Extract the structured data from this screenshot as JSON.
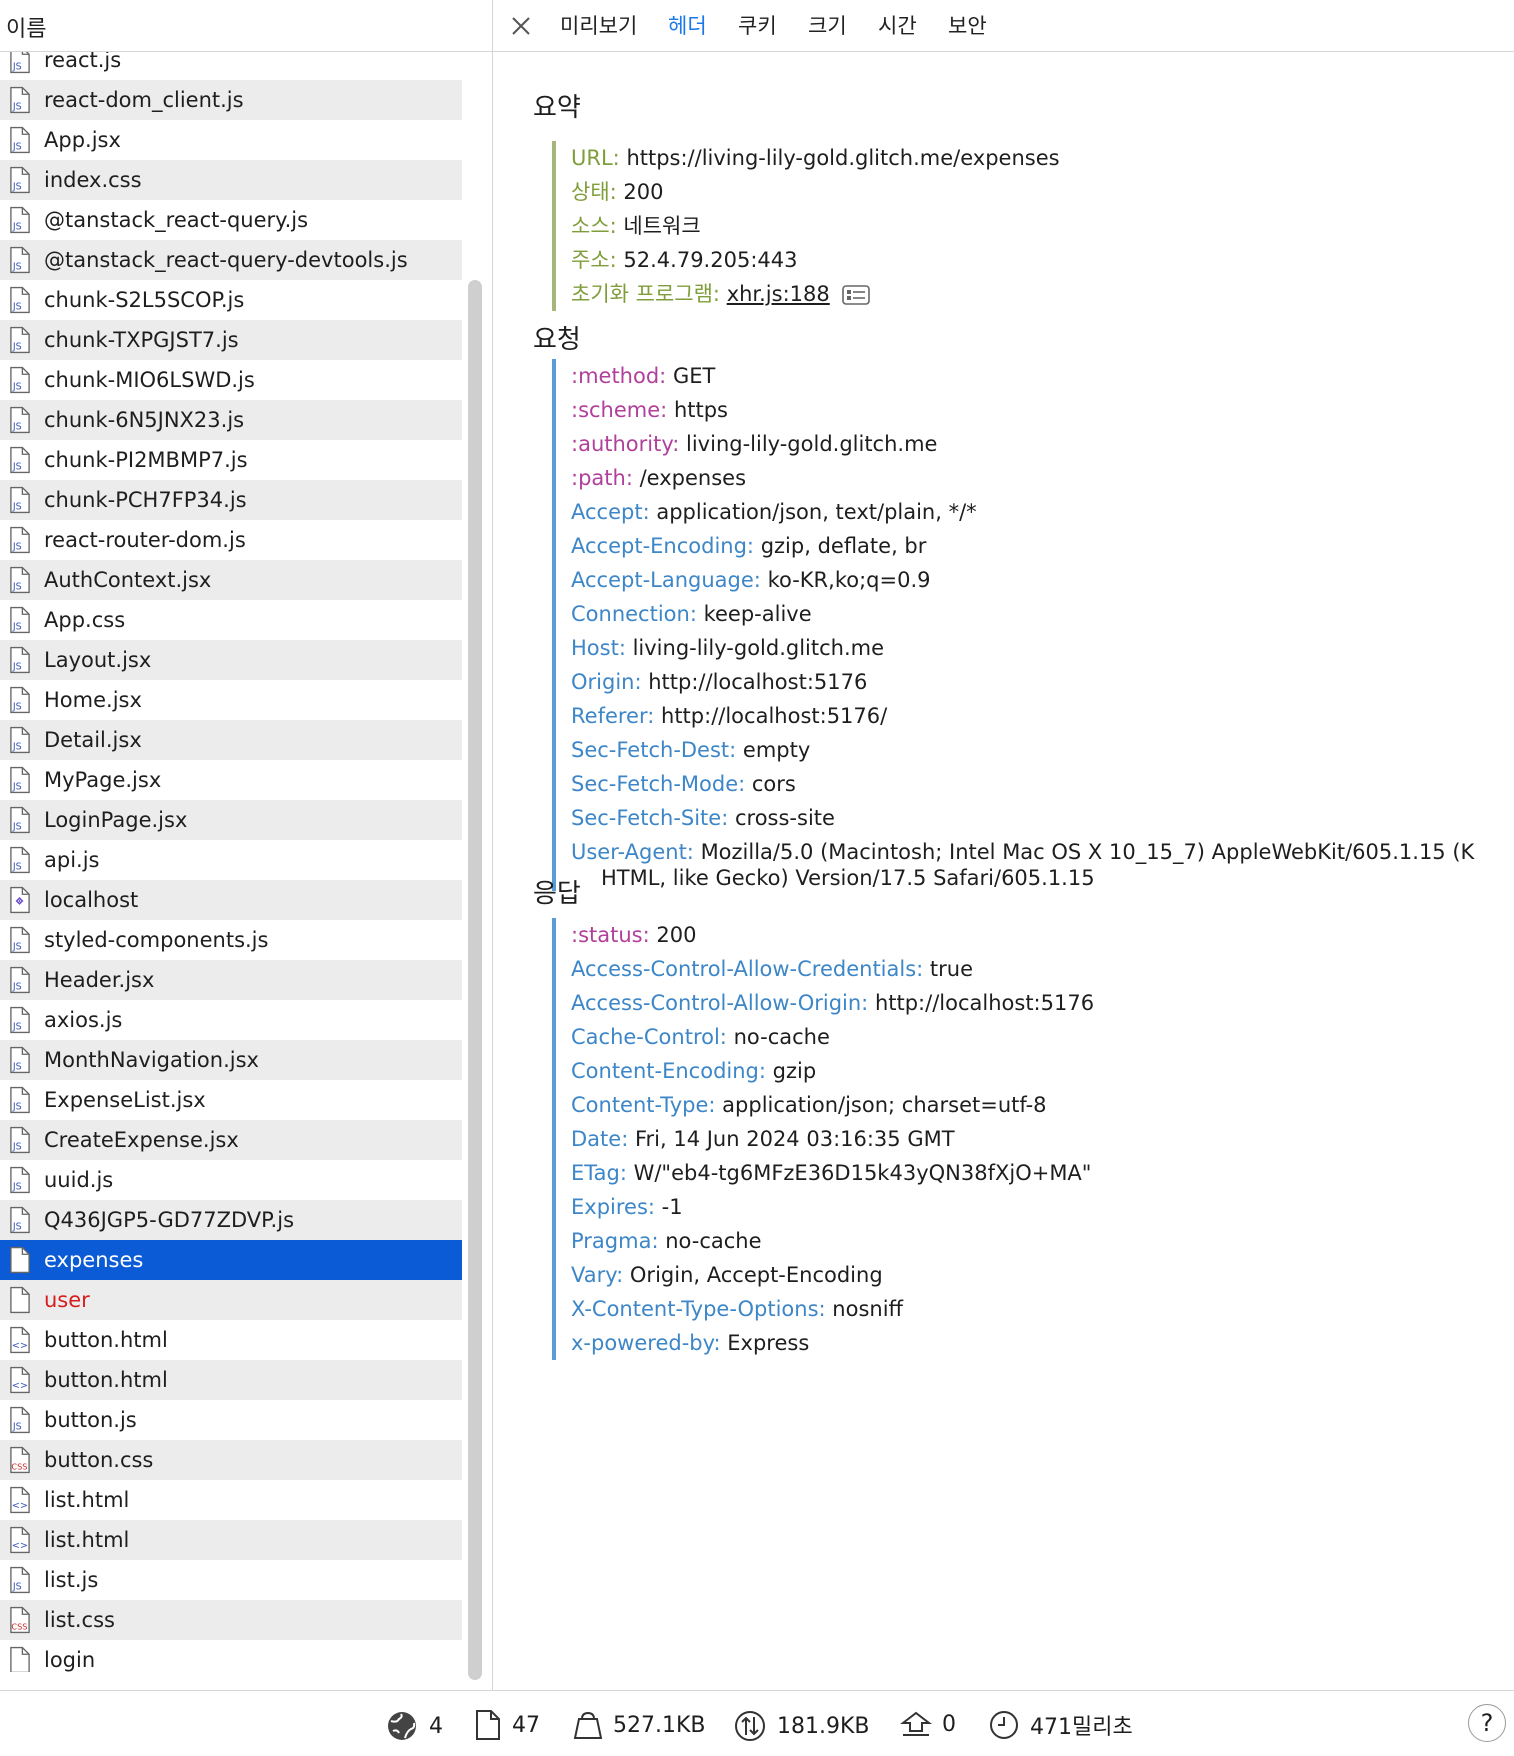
{
  "left": {
    "header": "이름",
    "files": [
      {
        "name": "react.js",
        "type": "js"
      },
      {
        "name": "react-dom_client.js",
        "type": "js"
      },
      {
        "name": "App.jsx",
        "type": "js"
      },
      {
        "name": "index.css",
        "type": "js"
      },
      {
        "name": "@tanstack_react-query.js",
        "type": "js"
      },
      {
        "name": "@tanstack_react-query-devtools.js",
        "type": "js"
      },
      {
        "name": "chunk-S2L5SCOP.js",
        "type": "js"
      },
      {
        "name": "chunk-TXPGJST7.js",
        "type": "js"
      },
      {
        "name": "chunk-MIO6LSWD.js",
        "type": "js"
      },
      {
        "name": "chunk-6N5JNX23.js",
        "type": "js"
      },
      {
        "name": "chunk-PI2MBMP7.js",
        "type": "js"
      },
      {
        "name": "chunk-PCH7FP34.js",
        "type": "js"
      },
      {
        "name": "react-router-dom.js",
        "type": "js"
      },
      {
        "name": "AuthContext.jsx",
        "type": "js"
      },
      {
        "name": "App.css",
        "type": "js"
      },
      {
        "name": "Layout.jsx",
        "type": "js"
      },
      {
        "name": "Home.jsx",
        "type": "js"
      },
      {
        "name": "Detail.jsx",
        "type": "js"
      },
      {
        "name": "MyPage.jsx",
        "type": "js"
      },
      {
        "name": "LoginPage.jsx",
        "type": "js"
      },
      {
        "name": "api.js",
        "type": "js"
      },
      {
        "name": "localhost",
        "type": "localhost"
      },
      {
        "name": "styled-components.js",
        "type": "js"
      },
      {
        "name": "Header.jsx",
        "type": "js"
      },
      {
        "name": "axios.js",
        "type": "js"
      },
      {
        "name": "MonthNavigation.jsx",
        "type": "js"
      },
      {
        "name": "ExpenseList.jsx",
        "type": "js"
      },
      {
        "name": "CreateExpense.jsx",
        "type": "js"
      },
      {
        "name": "uuid.js",
        "type": "js"
      },
      {
        "name": "Q436JGP5-GD77ZDVP.js",
        "type": "js"
      },
      {
        "name": "expenses",
        "type": "doc",
        "state": "selected"
      },
      {
        "name": "user",
        "type": "doc",
        "state": "error"
      },
      {
        "name": "button.html",
        "type": "html"
      },
      {
        "name": "button.html",
        "type": "html"
      },
      {
        "name": "button.js",
        "type": "js"
      },
      {
        "name": "button.css",
        "type": "css"
      },
      {
        "name": "list.html",
        "type": "html"
      },
      {
        "name": "list.html",
        "type": "html"
      },
      {
        "name": "list.js",
        "type": "js"
      },
      {
        "name": "list.css",
        "type": "css"
      },
      {
        "name": "login",
        "type": "doc"
      }
    ]
  },
  "tabs": [
    {
      "label": "미리보기",
      "active": false
    },
    {
      "label": "헤더",
      "active": true
    },
    {
      "label": "쿠키",
      "active": false
    },
    {
      "label": "크기",
      "active": false
    },
    {
      "label": "시간",
      "active": false
    },
    {
      "label": "보안",
      "active": false
    }
  ],
  "summary": {
    "title": "요약",
    "url_key": "URL:",
    "url_value": "https://living-lily-gold.glitch.me/expenses",
    "status_key": "상태:",
    "status_value": "200",
    "source_key": "소스:",
    "source_value": "네트워크",
    "address_key": "주소:",
    "address_value": "52.4.79.205:443",
    "initiator_key": "초기화 프로그램:",
    "initiator_value": "xhr.js:188"
  },
  "request": {
    "title": "요청",
    "headers": [
      {
        "key": ":method:",
        "value": "GET",
        "pseudo": true
      },
      {
        "key": ":scheme:",
        "value": "https",
        "pseudo": true
      },
      {
        "key": ":authority:",
        "value": "living-lily-gold.glitch.me",
        "pseudo": true
      },
      {
        "key": ":path:",
        "value": "/expenses",
        "pseudo": true
      },
      {
        "key": "Accept:",
        "value": "application/json, text/plain, */*"
      },
      {
        "key": "Accept-Encoding:",
        "value": "gzip, deflate, br"
      },
      {
        "key": "Accept-Language:",
        "value": "ko-KR,ko;q=0.9"
      },
      {
        "key": "Connection:",
        "value": "keep-alive"
      },
      {
        "key": "Host:",
        "value": "living-lily-gold.glitch.me"
      },
      {
        "key": "Origin:",
        "value": "http://localhost:5176"
      },
      {
        "key": "Referer:",
        "value": "http://localhost:5176/"
      },
      {
        "key": "Sec-Fetch-Dest:",
        "value": "empty"
      },
      {
        "key": "Sec-Fetch-Mode:",
        "value": "cors"
      },
      {
        "key": "Sec-Fetch-Site:",
        "value": "cross-site"
      }
    ],
    "user_agent_key": "User-Agent:",
    "user_agent_value_1": "Mozilla/5.0 (Macintosh; Intel Mac OS X 10_15_7) AppleWebKit/605.1.15 (K",
    "user_agent_value_2": "HTML, like Gecko) Version/17.5 Safari/605.1.15"
  },
  "response": {
    "title": "응답",
    "headers": [
      {
        "key": ":status:",
        "value": "200",
        "pseudo": true
      },
      {
        "key": "Access-Control-Allow-Credentials:",
        "value": "true"
      },
      {
        "key": "Access-Control-Allow-Origin:",
        "value": "http://localhost:5176"
      },
      {
        "key": "Cache-Control:",
        "value": "no-cache"
      },
      {
        "key": "Content-Encoding:",
        "value": "gzip"
      },
      {
        "key": "Content-Type:",
        "value": "application/json; charset=utf-8"
      },
      {
        "key": "Date:",
        "value": "Fri, 14 Jun 2024 03:16:35 GMT"
      },
      {
        "key": "ETag:",
        "value": "W/\"eb4-tg6MFzE36D15k43yQN38fXjO+MA\""
      },
      {
        "key": "Expires:",
        "value": "-1"
      },
      {
        "key": "Pragma:",
        "value": "no-cache"
      },
      {
        "key": "Vary:",
        "value": "Origin, Accept-Encoding"
      },
      {
        "key": "X-Content-Type-Options:",
        "value": "nosniff"
      },
      {
        "key": "x-powered-by:",
        "value": "Express"
      }
    ]
  },
  "status_bar": {
    "domains": "4",
    "resources": "47",
    "transferred": "527.1KB",
    "size": "181.9KB",
    "errors": "0",
    "time": "471밀리초",
    "help": "?"
  },
  "colors": {
    "selected_row": "#0b5ad6",
    "active_tab": "#1c78e8",
    "summary_key": "#7f9e3b",
    "pseudo_key": "#b1409a",
    "header_key": "#3d86c7",
    "error_text": "#d61d1d"
  }
}
